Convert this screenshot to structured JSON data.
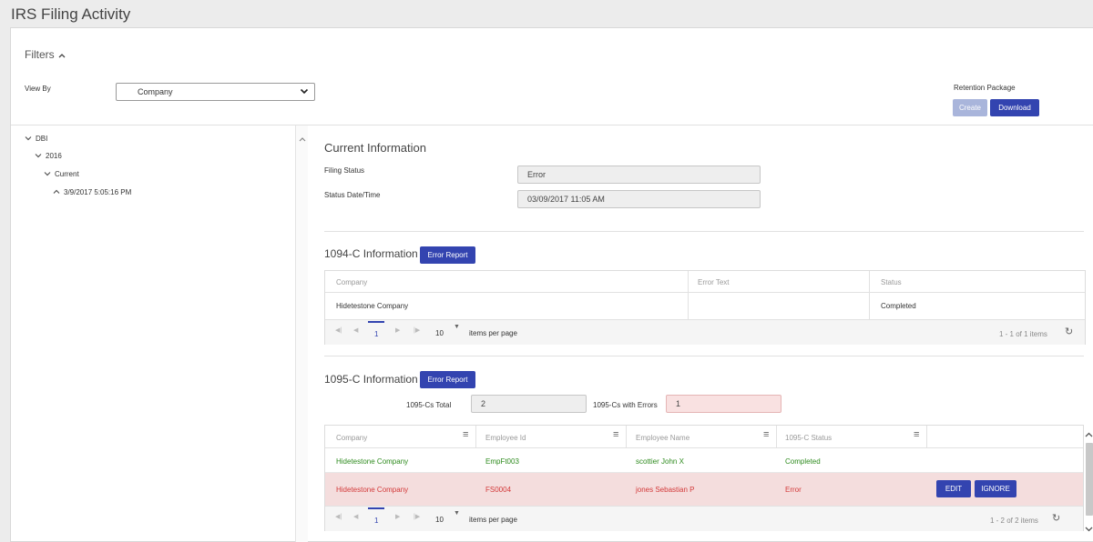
{
  "app": {
    "title": "IRS Filing Activity"
  },
  "filters": {
    "title": "Filters",
    "toggle_icon": "chevron-up-icon"
  },
  "view_by": {
    "label": "View By",
    "value": "Company"
  },
  "retention": {
    "label": "Retention Package",
    "create_label": "Create",
    "download_label": "Download"
  },
  "tree": {
    "items": [
      {
        "label": "DBI",
        "icon": "chevron-down-icon"
      },
      {
        "label": "2016",
        "icon": "chevron-down-icon"
      },
      {
        "label": "Current",
        "icon": "chevron-down-icon"
      },
      {
        "label": "3/9/2017 5:05:16 PM",
        "icon": "chevron-up-icon"
      }
    ]
  },
  "current_info": {
    "title": "Current Information",
    "filing_status_label": "Filing Status",
    "filing_status_value": "Error",
    "status_datetime_label": "Status Date/Time",
    "status_datetime_value": "03/09/2017 11:05 AM"
  },
  "info_1094": {
    "title": "1094-C Information",
    "error_report_label": "Error Report",
    "columns": [
      "Company",
      "Error Text",
      "Status"
    ],
    "rows": [
      {
        "company": "Hidetestone Company",
        "error_text": "",
        "status": "Completed"
      }
    ],
    "pager": {
      "page": "1",
      "page_size": "10",
      "items_per_page_label": "items per page",
      "info": "1 - 1 of 1 items"
    }
  },
  "info_1095": {
    "title": "1095-C Information",
    "error_report_label": "Error Report",
    "total_label": "1095-Cs Total",
    "total_value": "2",
    "errors_label": "1095-Cs with Errors",
    "errors_value": "1",
    "columns": [
      "Company",
      "Employee Id",
      "Employee Name",
      "1095-C Status"
    ],
    "rows": [
      {
        "company": "Hidetestone Company",
        "employee_id": "EmpFt003",
        "employee_name": "scottier John X",
        "status": "Completed"
      },
      {
        "company": "Hidetestone Company",
        "employee_id": "FS0004",
        "employee_name": "jones Sebastian P",
        "status": "Error",
        "edit_label": "EDIT",
        "ignore_label": "IGNORE"
      }
    ],
    "pager": {
      "page": "1",
      "page_size": "10",
      "items_per_page_label": "items per page",
      "info": "1 - 2 of 2 items"
    }
  },
  "colors": {
    "accent": "#3344b0",
    "success": "#2e8b1e",
    "error": "#d33a3a",
    "error_row_bg": "#f4dddd"
  }
}
